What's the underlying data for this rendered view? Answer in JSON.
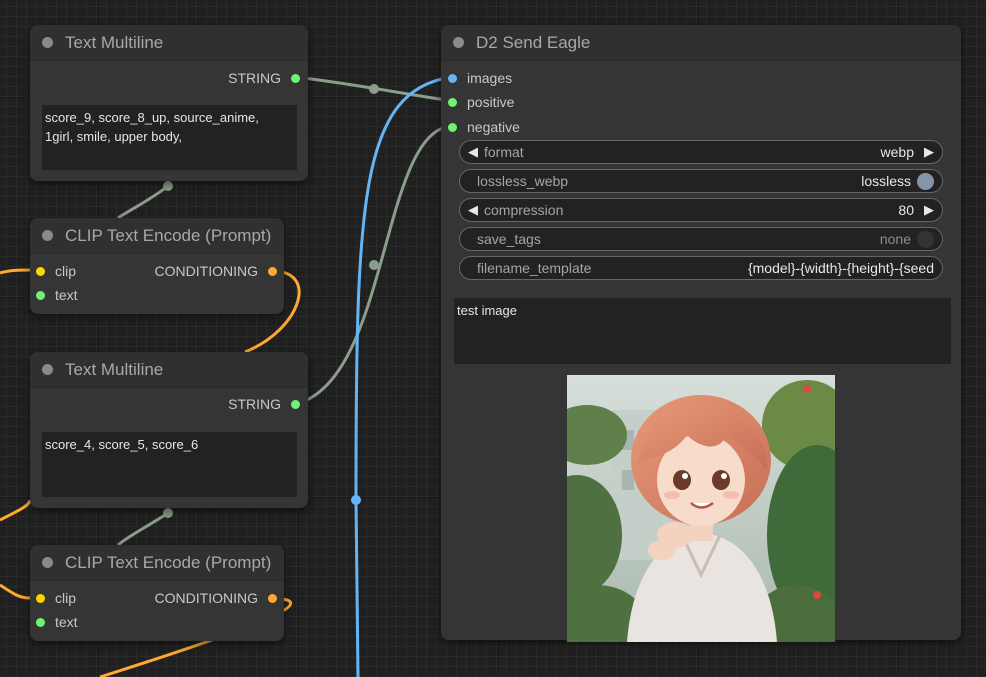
{
  "nodes": {
    "text_multiline_1": {
      "title": "Text Multiline",
      "output_label": "STRING",
      "text": "score_9, score_8_up, source_anime,\n1girl, smile, upper body,"
    },
    "clip_encode_1": {
      "title": "CLIP Text Encode (Prompt)",
      "input_clip": "clip",
      "input_text": "text",
      "output_label": "CONDITIONING"
    },
    "text_multiline_2": {
      "title": "Text Multiline",
      "output_label": "STRING",
      "text": "score_4, score_5, score_6"
    },
    "clip_encode_2": {
      "title": "CLIP Text Encode (Prompt)",
      "input_clip": "clip",
      "input_text": "text",
      "output_label": "CONDITIONING"
    },
    "send_eagle": {
      "title": "D2 Send Eagle",
      "inputs": [
        "images",
        "positive",
        "negative"
      ],
      "widgets": {
        "format": {
          "label": "format",
          "value": "webp"
        },
        "lossless_webp": {
          "label": "lossless_webp",
          "value": "lossless"
        },
        "compression": {
          "label": "compression",
          "value": "80"
        },
        "save_tags": {
          "label": "save_tags",
          "value": "none"
        },
        "filename_template": {
          "label": "filename_template",
          "value": "{model}-{width}-{height}-{seed"
        }
      },
      "memo": "test image",
      "preview_image": "anime-girl-portrait"
    }
  },
  "colors": {
    "string_slot": "#72f272",
    "clip_slot": "#ffd500",
    "conditioning_slot": "#ffa931",
    "image_slot": "#64b5f6",
    "string_link": "#8a9e8a",
    "image_link": "#64b5f6",
    "conditioning_link": "#ffa931"
  }
}
